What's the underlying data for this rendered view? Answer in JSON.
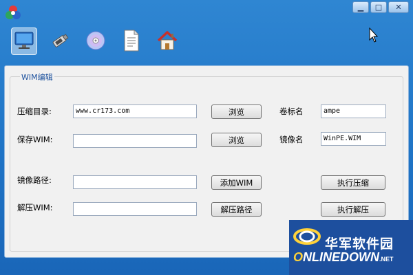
{
  "window": {
    "controls": {
      "minimize": "▁",
      "maximize": "□",
      "close": "✕"
    }
  },
  "toolbar": {
    "items": [
      {
        "icon": "monitor-icon",
        "active": true
      },
      {
        "icon": "usb-drive-icon"
      },
      {
        "icon": "disc-icon"
      },
      {
        "icon": "document-icon"
      },
      {
        "icon": "home-icon"
      }
    ]
  },
  "group": {
    "title": "WIM编辑"
  },
  "form": {
    "compress_dir_label": "压缩目录:",
    "compress_dir_value": "www.cr173.com",
    "save_wim_label": "保存WIM:",
    "save_wim_value": "",
    "image_path_label": "镜像路径:",
    "image_path_value": "",
    "extract_wim_label": "解压WIM:",
    "extract_wim_value": "",
    "volume_name_label": "卷标名",
    "volume_name_value": "ampe",
    "image_name_label": "镜像名",
    "image_name_value": "WinPE.WIM"
  },
  "buttons": {
    "browse1": "浏览",
    "browse2": "浏览",
    "add_wim": "添加WIM",
    "extract_path": "解压路径",
    "run_compress": "执行压缩",
    "run_extract": "执行解压"
  },
  "watermark": {
    "cn": "华军软件园",
    "en": "NLINEDOWN",
    "en_suffix": ".NET"
  },
  "colors": {
    "accent": "#1f74c6",
    "group_title": "#1a4f9c"
  }
}
